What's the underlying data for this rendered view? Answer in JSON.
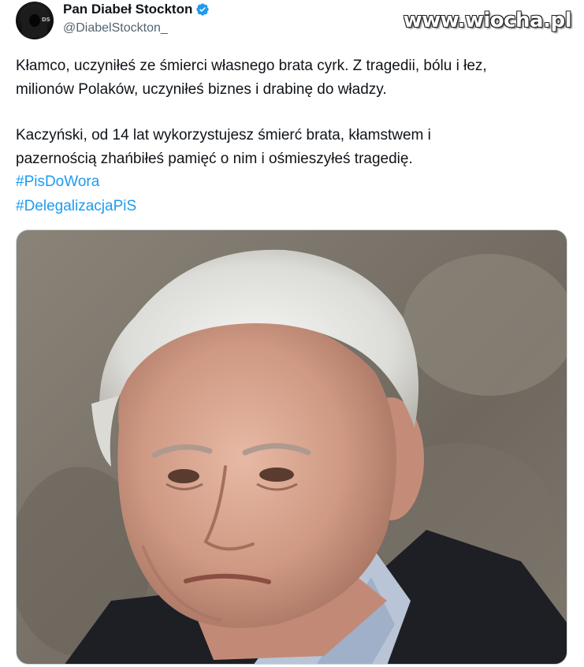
{
  "tweet": {
    "author": {
      "display_name": "Pan Diabeł Stockton",
      "handle": "@DiabelStockton_",
      "verified": true,
      "avatar_text": "DS"
    },
    "watermark": "www.wiocha.pl",
    "paragraph1_line1": "Kłamco, uczyniłeś ze śmierci własnego brata cyrk. Z tragedii, bólu i łez,",
    "paragraph1_line2": "milionów Polaków, uczyniłeś biznes i drabinę do władzy.",
    "paragraph2_line1": "Kaczyński, od 14 lat wykorzystujesz śmierć brata, kłamstwem i",
    "paragraph2_line2": "pazernością zhańbiłeś pamięć o nim i ośmieszyłeś tragedię.",
    "hashtags": [
      "#PisDoWora",
      "#DelegalizacjaPiS"
    ],
    "colors": {
      "link": "#1d9bf0",
      "verified": "#1d9bf0",
      "text": "#0f1419",
      "secondary": "#536471"
    }
  }
}
